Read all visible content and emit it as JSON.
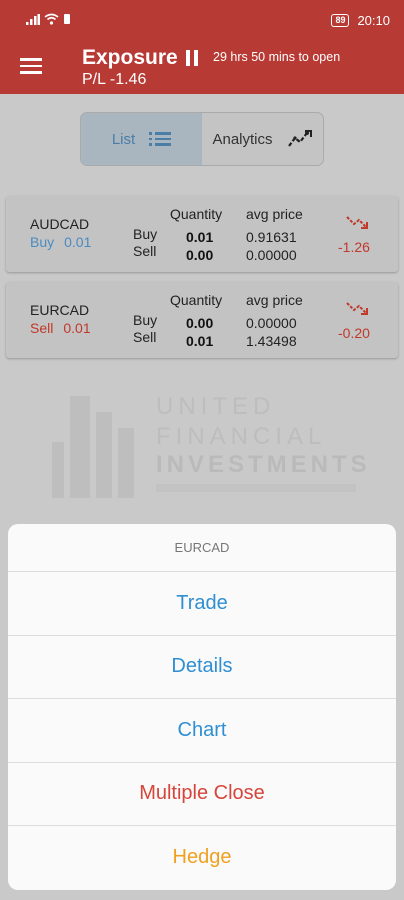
{
  "status_bar": {
    "time": "20:10",
    "battery": "89"
  },
  "app_bar": {
    "title": "Exposure",
    "countdown": "29 hrs 50 mins to open",
    "pl": "P/L -1.46"
  },
  "tabs": [
    {
      "label": "List",
      "active": true,
      "icon": "list-icon"
    },
    {
      "label": "Analytics",
      "active": false,
      "icon": "analytics-icon"
    }
  ],
  "positions": [
    {
      "symbol": "AUDCAD",
      "side": "Buy",
      "size": "0.01",
      "qty_header": "Quantity",
      "avg_header": "avg price",
      "buy_label": "Buy",
      "sell_label": "Sell",
      "buy_qty": "0.01",
      "sell_qty": "0.00",
      "buy_price": "0.91631",
      "sell_price": "0.00000",
      "pnl": "-1.26"
    },
    {
      "symbol": "EURCAD",
      "side": "Sell",
      "size": "0.01",
      "qty_header": "Quantity",
      "avg_header": "avg price",
      "buy_label": "Buy",
      "sell_label": "Sell",
      "buy_qty": "0.00",
      "sell_qty": "0.01",
      "buy_price": "0.00000",
      "sell_price": "1.43498",
      "pnl": "-0.20"
    }
  ],
  "watermark": {
    "line1": "UNITED",
    "line2": "FINANCIAL",
    "line3": "INVESTMENTS"
  },
  "action_sheet": {
    "title": "EURCAD",
    "items": [
      {
        "label": "Trade",
        "color": "#2f8fd2"
      },
      {
        "label": "Details",
        "color": "#2f8fd2"
      },
      {
        "label": "Chart",
        "color": "#2f8fd2"
      },
      {
        "label": "Multiple Close",
        "color": "#d6453a"
      },
      {
        "label": "Hedge",
        "color": "#f0a020"
      }
    ]
  },
  "colors": {
    "brand": "#b83a35",
    "buy": "#4a8bc2",
    "sell": "#c0392b"
  }
}
